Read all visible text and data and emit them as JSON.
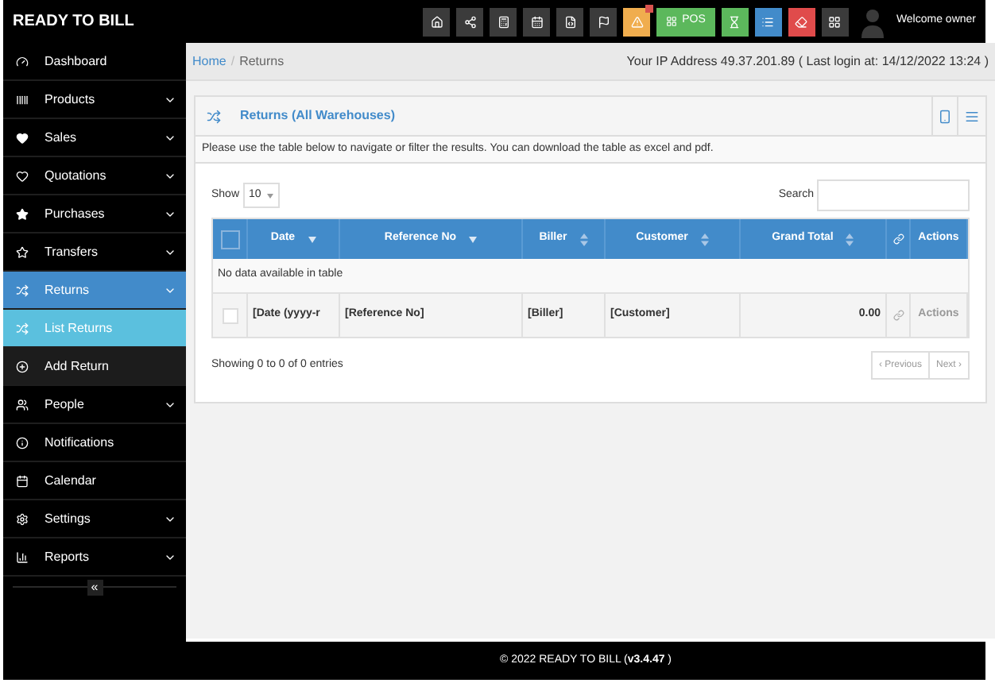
{
  "header": {
    "brand": "READY TO BILL",
    "pos_label": "POS",
    "user": "Welcome owner",
    "alert_badge": true
  },
  "sidebar": {
    "items": [
      {
        "label": "Dashboard",
        "caret": false,
        "selected": false
      },
      {
        "label": "Products",
        "caret": true,
        "selected": false
      },
      {
        "label": "Sales",
        "caret": true,
        "selected": false
      },
      {
        "label": "Quotations",
        "caret": true,
        "selected": false
      },
      {
        "label": "Purchases",
        "caret": true,
        "selected": false
      },
      {
        "label": "Transfers",
        "caret": true,
        "selected": false
      },
      {
        "label": "Returns",
        "caret": true,
        "selected": true,
        "expanded": true,
        "children": [
          {
            "label": "List Returns",
            "selected": true
          },
          {
            "label": "Add Return",
            "selected": false
          }
        ]
      },
      {
        "label": "People",
        "caret": true,
        "selected": false
      },
      {
        "label": "Notifications",
        "caret": false,
        "selected": false
      },
      {
        "label": "Calendar",
        "caret": false,
        "selected": false
      },
      {
        "label": "Settings",
        "caret": true,
        "selected": false
      },
      {
        "label": "Reports",
        "caret": true,
        "selected": false
      }
    ],
    "collapse": "«"
  },
  "breadcrumb": {
    "items": [
      "Home",
      "Returns"
    ],
    "separator": "/",
    "info": "Your IP Address 49.37.201.89 ( Last login at: 14/12/2022 13:24 )"
  },
  "panel": {
    "title": "Returns (All Warehouses)",
    "intro": "Please use the table below to navigate or filter the results. You can download the table as excel and pdf.",
    "show_label": "Show",
    "page_size": "10",
    "search_label": "Search",
    "table": {
      "columns": [
        {
          "kind": "check",
          "checked": false
        },
        {
          "kind": "text",
          "label": "Date",
          "sorted": true
        },
        {
          "kind": "text",
          "label": "Reference No",
          "sorted": true
        },
        {
          "kind": "text",
          "label": "Biller",
          "sorted": false
        },
        {
          "kind": "text",
          "label": "Customer",
          "sorted": false
        },
        {
          "kind": "text",
          "label": "Grand Total",
          "sorted": false
        },
        {
          "kind": "link"
        },
        {
          "kind": "text",
          "label": "Actions"
        }
      ],
      "empty_message": "No data available in table",
      "footer": [
        {
          "kind": "check",
          "checked": false
        },
        {
          "kind": "text",
          "text": "[Date (yyyy-r"
        },
        {
          "kind": "text",
          "text": "[Reference No]"
        },
        {
          "kind": "text",
          "text": "[Biller]"
        },
        {
          "kind": "text",
          "text": "[Customer]"
        },
        {
          "kind": "number",
          "text": "0.00"
        },
        {
          "kind": "link"
        },
        {
          "kind": "muted",
          "text": "Actions"
        }
      ]
    },
    "showing": "Showing 0 to 0 of 0 entries",
    "prev": "‹ Previous",
    "next": "Next ›"
  },
  "footer": {
    "copyright": "© 2022 READY TO BILL (",
    "version": "v3.4.47",
    "close": " )"
  }
}
